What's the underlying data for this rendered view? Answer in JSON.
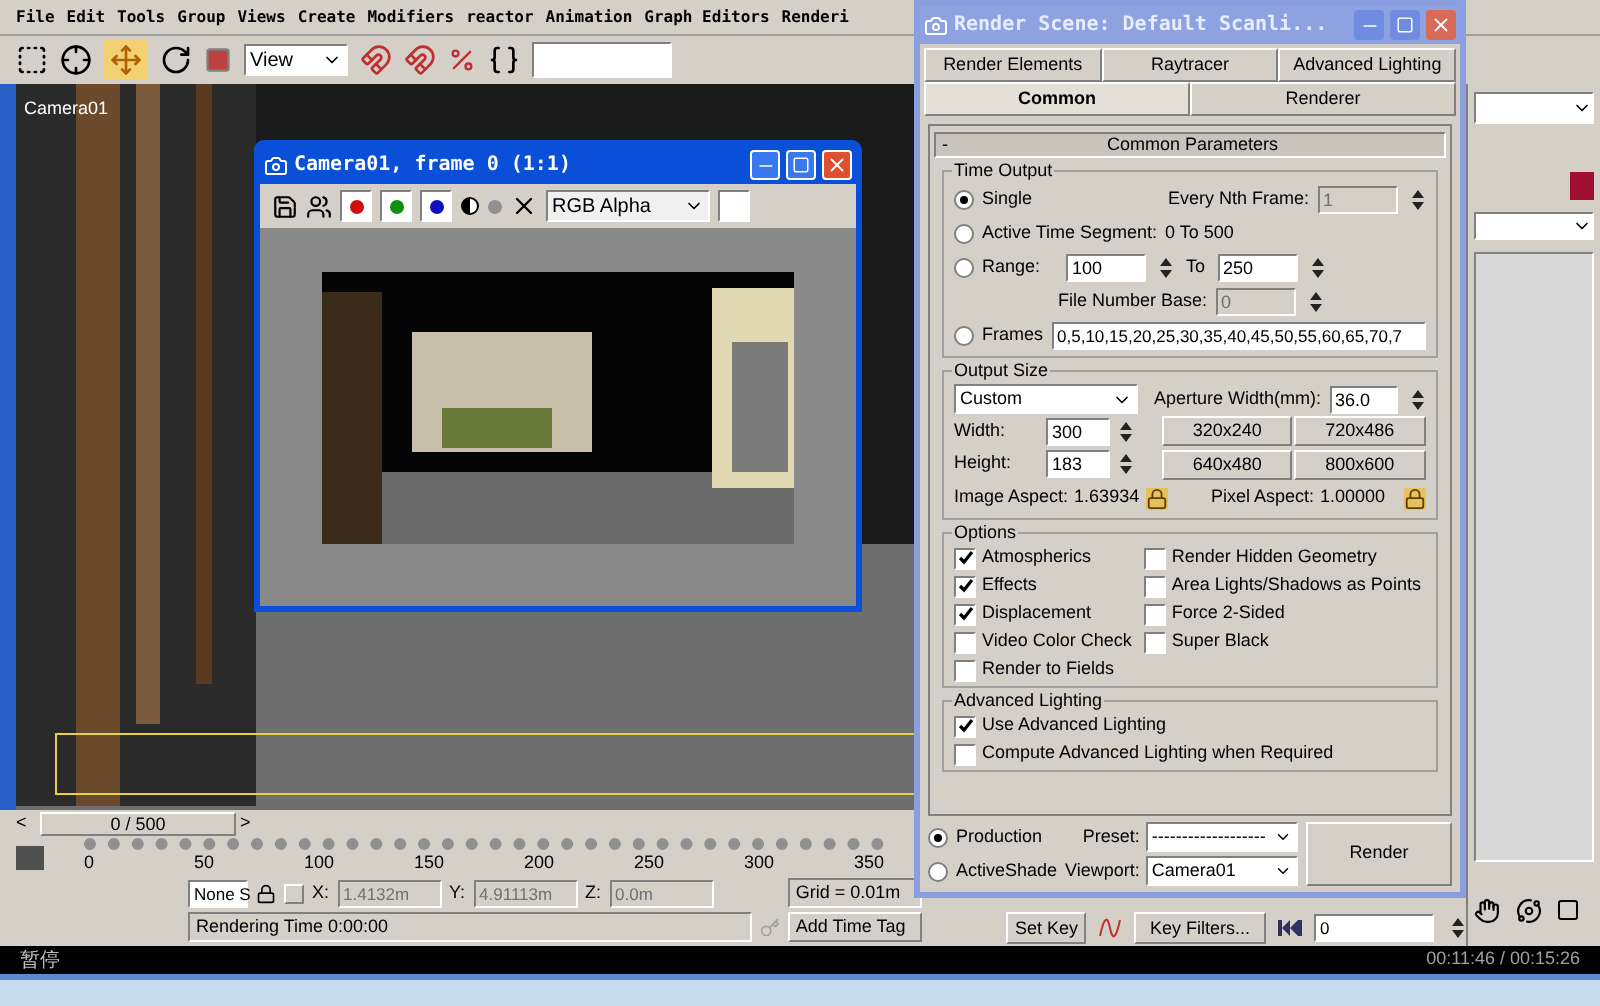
{
  "menu_bar": [
    "File",
    "Edit",
    "Tools",
    "Group",
    "Views",
    "Create",
    "Modifiers",
    "reactor",
    "Animation",
    "Graph Editors",
    "Renderi"
  ],
  "toolbar": {
    "view_dropdown": "View"
  },
  "viewport": {
    "label": "Camera01"
  },
  "time_slider": {
    "position": "0 / 500",
    "prev": "<",
    "next": ">"
  },
  "ruler_ticks": [
    "0",
    "50",
    "100",
    "150",
    "200",
    "250",
    "300",
    "350"
  ],
  "status": {
    "selection": "None S",
    "x_label": "X:",
    "x": "1.4132m",
    "y_label": "Y:",
    "y": "4.91113m",
    "z_label": "Z:",
    "z": "0.0m",
    "grid": "Grid = 0.01m",
    "prompt": "Rendering Time  0:00:00",
    "add_time_tag": "Add Time Tag"
  },
  "animation_controls": {
    "set_key": "Set Key",
    "key_filters": "Key Filters...",
    "frame": "0"
  },
  "playback_bar": {
    "status": "暂停",
    "time": "00:11:46 / 00:15:26"
  },
  "frame_window": {
    "title": "Camera01, frame 0 (1:1)",
    "channels": [
      {
        "color": "#d01010",
        "on": true
      },
      {
        "color": "#109010",
        "on": true
      },
      {
        "color": "#1010c0",
        "on": true
      }
    ],
    "channel_display": "RGB Alpha"
  },
  "render_dialog": {
    "title": "Render Scene: Default Scanli...",
    "tab_rows": [
      [
        {
          "label": "Render Elements",
          "selected": false
        },
        {
          "label": "Raytracer",
          "selected": false
        },
        {
          "label": "Advanced Lighting",
          "selected": false
        }
      ],
      [
        {
          "label": "Common",
          "selected": true
        },
        {
          "label": "Renderer",
          "selected": false
        }
      ]
    ],
    "rollout": {
      "toggle": "-",
      "title": "Common Parameters"
    },
    "time_output": {
      "title": "Time Output",
      "every_nth": {
        "label": "Every Nth Frame:",
        "value": "1",
        "disabled": true
      },
      "modes": [
        {
          "kind": "single",
          "label": "Single",
          "selected": true
        },
        {
          "kind": "segment",
          "label": "Active Time Segment:",
          "value": "0 To 500",
          "selected": false
        },
        {
          "kind": "range",
          "label": "Range:",
          "from": "100",
          "to_label": "To",
          "to": "250",
          "selected": false
        },
        {
          "kind": "frames",
          "label": "Frames",
          "value": "0,5,10,15,20,25,30,35,40,45,50,55,60,65,70,7",
          "selected": false
        }
      ],
      "file_number_base": {
        "label": "File Number Base:",
        "value": "0",
        "disabled": true
      }
    },
    "output_size": {
      "title": "Output Size",
      "preset": "Custom",
      "aperture": {
        "label": "Aperture Width(mm):",
        "value": "36.0"
      },
      "width": {
        "label": "Width:",
        "value": "300"
      },
      "height": {
        "label": "Height:",
        "value": "183"
      },
      "resolutions": [
        "320x240",
        "720x486",
        "640x480",
        "800x600"
      ],
      "image_aspect": {
        "label": "Image Aspect:",
        "value": "1.63934"
      },
      "pixel_aspect": {
        "label": "Pixel Aspect:",
        "value": "1.00000"
      }
    },
    "options": {
      "title": "Options",
      "columns": [
        [
          {
            "label": "Atmospherics",
            "checked": true
          },
          {
            "label": "Effects",
            "checked": true
          },
          {
            "label": "Displacement",
            "checked": true
          },
          {
            "label": "Video Color Check",
            "checked": false
          },
          {
            "label": "Render to Fields",
            "checked": false
          }
        ],
        [
          {
            "label": "Render Hidden Geometry",
            "checked": false
          },
          {
            "label": "Area Lights/Shadows as Points",
            "checked": false
          },
          {
            "label": "Force 2-Sided",
            "checked": false
          },
          {
            "label": "Super Black",
            "checked": false
          }
        ]
      ]
    },
    "advanced_lighting": {
      "title": "Advanced Lighting",
      "items": [
        {
          "label": "Use Advanced Lighting",
          "checked": true
        },
        {
          "label": "Compute Advanced Lighting when Required",
          "checked": false
        }
      ]
    },
    "footer": {
      "modes": [
        {
          "label": "Production",
          "selected": true
        },
        {
          "label": "ActiveShade",
          "selected": false
        }
      ],
      "preset": {
        "label": "Preset:",
        "value": "-------------------"
      },
      "viewport": {
        "label": "Viewport:",
        "value": "Camera01"
      },
      "render_button": "Render"
    }
  }
}
